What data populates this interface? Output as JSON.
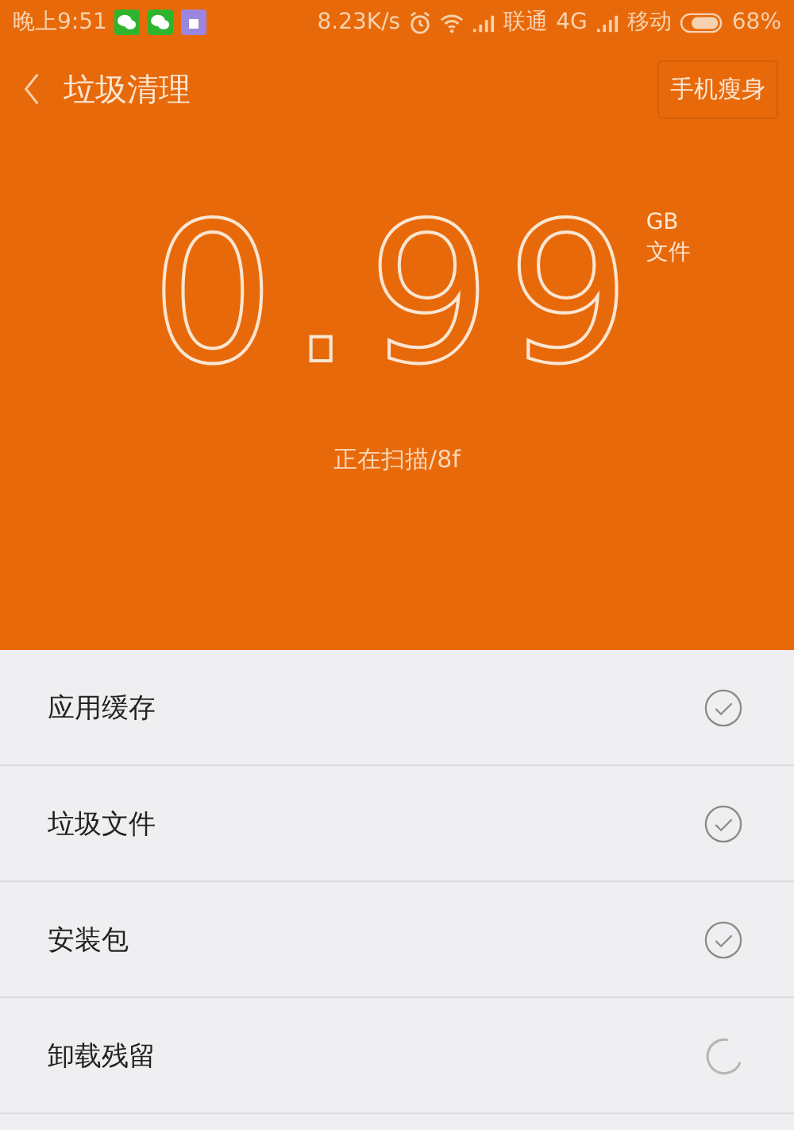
{
  "status_bar": {
    "time": "晚上9:51",
    "speed": "8.23K/s",
    "carrier_1": "联通",
    "network_1": "4G",
    "carrier_2": "移动",
    "battery": "68%"
  },
  "header": {
    "title": "垃圾清理",
    "action": "手机瘦身"
  },
  "scan": {
    "amount": "0.99",
    "unit": "GB",
    "unit_label": "文件",
    "status": "正在扫描/8f"
  },
  "items": [
    {
      "label": "应用缓存",
      "kind": "done"
    },
    {
      "label": "垃圾文件",
      "kind": "done"
    },
    {
      "label": "安装包",
      "kind": "done"
    },
    {
      "label": "卸载残留",
      "kind": "scanning"
    }
  ]
}
